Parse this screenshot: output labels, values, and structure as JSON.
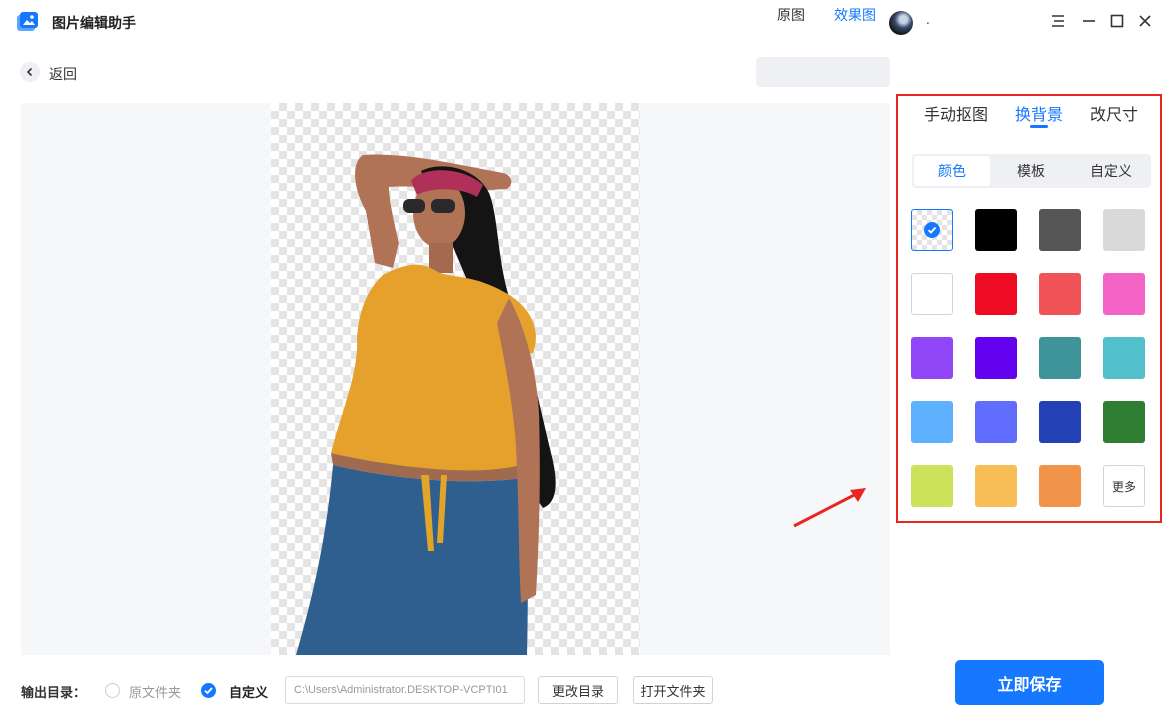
{
  "app": {
    "title": "图片编辑助手",
    "user_name": "."
  },
  "nav": {
    "back_label": "返回"
  },
  "view_toggle": {
    "original": "原图",
    "effect": "效果图",
    "selected": "效果图"
  },
  "panel": {
    "tabs": [
      "手动抠图",
      "换背景",
      "改尺寸"
    ],
    "active_tab": "换背景",
    "subtabs": [
      "颜色",
      "模板",
      "自定义"
    ],
    "active_subtab": "颜色",
    "swatches": [
      "transparent",
      "#000000",
      "#555555",
      "#d9d9d9",
      "#ffffff",
      "#ee0c22",
      "#ef5355",
      "#f464c7",
      "#8f47f8",
      "#6302ef",
      "#3e9498",
      "#52c0cb",
      "#5eb1fe",
      "#616dfe",
      "#2241b5",
      "#2f7e31",
      "#cce25a",
      "#f7be55",
      "#f2934a"
    ],
    "selected_swatch_index": 0,
    "more_label": "更多"
  },
  "bottom": {
    "output_label": "输出目录：",
    "option_original": "原文件夹",
    "option_custom": "自定义",
    "selected_option": "自定义",
    "path_value": "C:\\Users\\Administrator.DESKTOP-VCPTI01",
    "change_dir_label": "更改目录",
    "open_folder_label": "打开文件夹",
    "save_label": "立即保存"
  },
  "colors": {
    "accent": "#1677ff",
    "highlight_frame": "#e8261f"
  }
}
